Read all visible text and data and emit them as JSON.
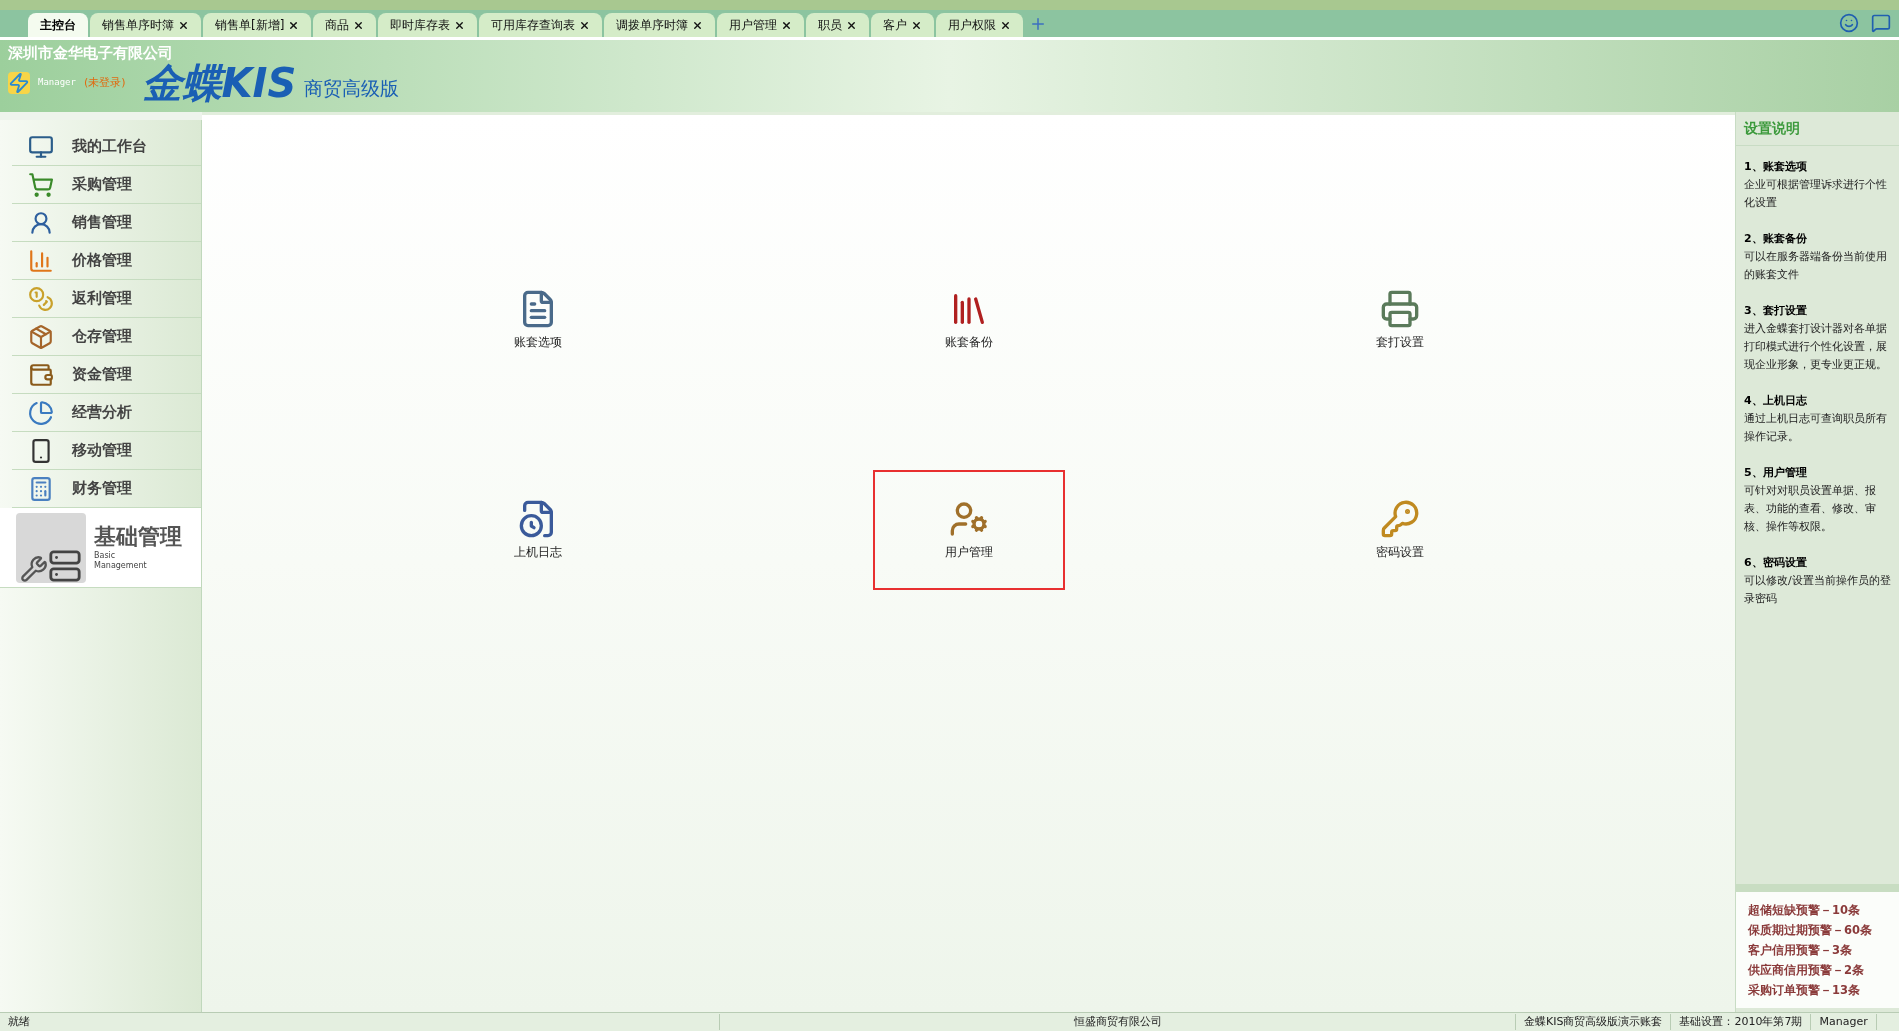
{
  "tabs": [
    {
      "label": "主控台",
      "selected": true,
      "closable": false
    },
    {
      "label": "销售单序时簿",
      "selected": false,
      "closable": true
    },
    {
      "label": "销售单[新增]",
      "selected": false,
      "closable": true
    },
    {
      "label": "商品",
      "selected": false,
      "closable": true
    },
    {
      "label": "即时库存表",
      "selected": false,
      "closable": true
    },
    {
      "label": "可用库存查询表",
      "selected": false,
      "closable": true
    },
    {
      "label": "调拨单序时簿",
      "selected": false,
      "closable": true
    },
    {
      "label": "用户管理",
      "selected": false,
      "closable": true
    },
    {
      "label": "职员",
      "selected": false,
      "closable": true
    },
    {
      "label": "客户",
      "selected": false,
      "closable": true
    },
    {
      "label": "用户权限",
      "selected": false,
      "closable": true
    }
  ],
  "header": {
    "company": "深圳市金华电子有限公司",
    "user": "Manager",
    "login_state": "(未登录)",
    "logo_brand": "金蝶KIS",
    "logo_edition": "商贸高级版"
  },
  "sidebar": {
    "items": [
      {
        "label": "我的工作台",
        "kind": "monitor",
        "selected": false
      },
      {
        "label": "采购管理",
        "kind": "purchase",
        "selected": false
      },
      {
        "label": "销售管理",
        "kind": "sales",
        "selected": false
      },
      {
        "label": "价格管理",
        "kind": "price",
        "selected": false
      },
      {
        "label": "返利管理",
        "kind": "rebate",
        "selected": false
      },
      {
        "label": "仓存管理",
        "kind": "stock",
        "selected": false
      },
      {
        "label": "资金管理",
        "kind": "fund",
        "selected": false
      },
      {
        "label": "经营分析",
        "kind": "analysis",
        "selected": false
      },
      {
        "label": "移动管理",
        "kind": "mobile",
        "selected": false
      },
      {
        "label": "财务管理",
        "kind": "finance",
        "selected": false
      },
      {
        "label": "基础管理",
        "subtitle_1": "Basic",
        "subtitle_2": "Management",
        "kind": "basic",
        "selected": true
      }
    ]
  },
  "functions": [
    {
      "label": "账套选项",
      "kind": "options",
      "selected": false
    },
    {
      "label": "账套备份",
      "kind": "backup",
      "selected": false
    },
    {
      "label": "套打设置",
      "kind": "print",
      "selected": false
    },
    {
      "label": "上机日志",
      "kind": "log",
      "selected": false
    },
    {
      "label": "用户管理",
      "kind": "users",
      "selected": true
    },
    {
      "label": "密码设置",
      "kind": "password",
      "selected": false
    }
  ],
  "help_panel": {
    "title": "设置说明",
    "notes": [
      {
        "title": "1、账套选项",
        "text": "企业可根据管理诉求进行个性化设置"
      },
      {
        "title": "2、账套备份",
        "text": "可以在服务器端备份当前使用的账套文件"
      },
      {
        "title": "3、套打设置",
        "text": "进入金蝶套打设计器对各单据打印模式进行个性化设置，展现企业形象，更专业更正规。"
      },
      {
        "title": "4、上机日志",
        "text": "通过上机日志可查询职员所有操作记录。"
      },
      {
        "title": "5、用户管理",
        "text": "可针对对职员设置单据、报表、功能的查看、修改、审核、操作等权限。"
      },
      {
        "title": "6、密码设置",
        "text": "可以修改/设置当前操作员的登录密码"
      }
    ]
  },
  "alerts": [
    "超储短缺预警－10条",
    "保质期过期预警－60条",
    "客户信用预警－3条",
    "供应商信用预警－2条",
    "采购订单预警－13条"
  ],
  "status_bar": [
    "就绪",
    "恒盛商贸有限公司",
    "金蝶KIS商贸高级版演示账套",
    "基础设置：2010年第7期",
    "Manager"
  ]
}
